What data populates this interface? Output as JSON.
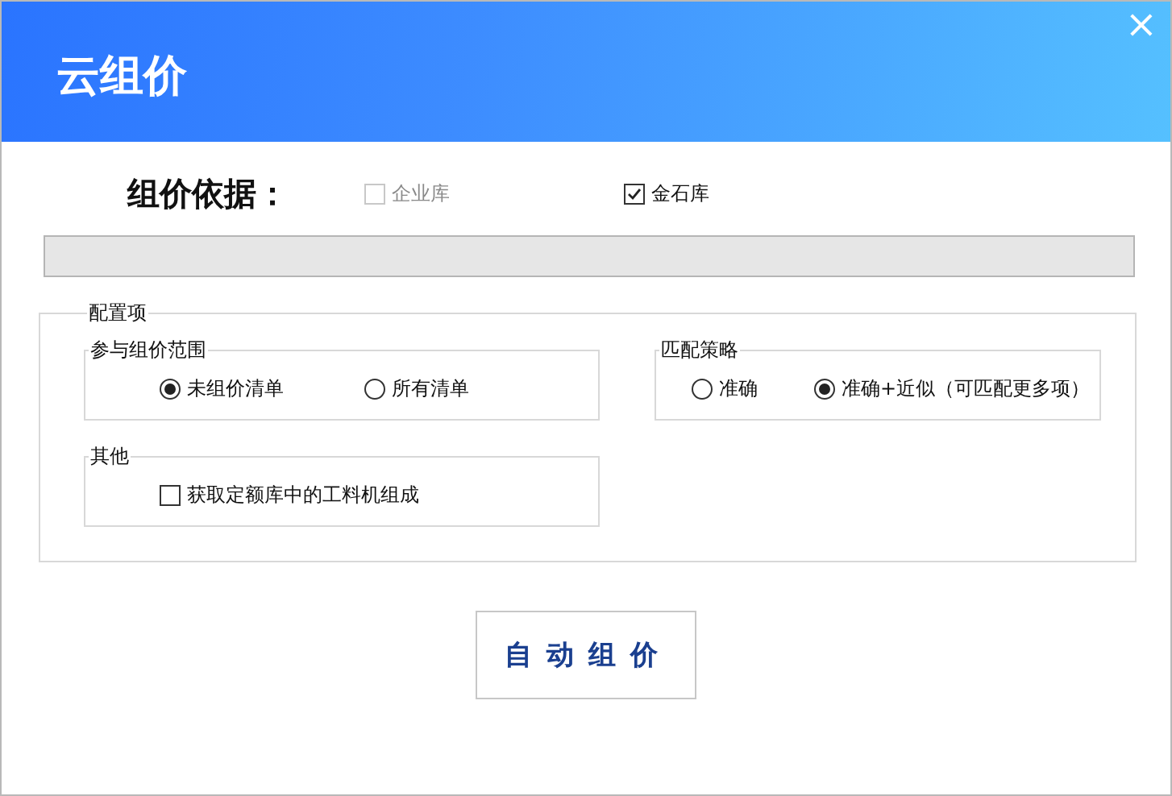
{
  "window": {
    "title": "云组价",
    "close": "×"
  },
  "basis": {
    "label": "组价依据：",
    "options": [
      {
        "label": "企业库",
        "checked": false,
        "disabled": true
      },
      {
        "label": "金石库",
        "checked": true,
        "disabled": false
      }
    ]
  },
  "progress": {
    "level": 0
  },
  "config": {
    "title": "配置项",
    "scope": {
      "title": "参与组价范围",
      "options": [
        {
          "label": "未组价清单",
          "selected": true
        },
        {
          "label": "所有清单",
          "selected": false
        }
      ]
    },
    "strategy": {
      "title": "匹配策略",
      "options": [
        {
          "label": "准确",
          "selected": false
        },
        {
          "label": "准确+近似（可匹配更多项）",
          "selected": true
        }
      ]
    },
    "other": {
      "title": "其他",
      "options": [
        {
          "label": "获取定额库中的工料机组成",
          "checked": false
        }
      ]
    }
  },
  "button": "自动组价"
}
